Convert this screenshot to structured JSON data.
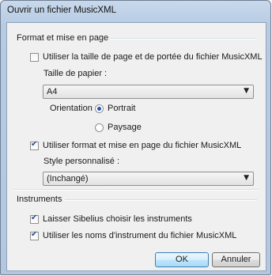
{
  "window": {
    "title": "Ouvrir un fichier MusicXML"
  },
  "format_section": {
    "label": "Format et mise en page",
    "use_page_size": {
      "label": "Utiliser la taille de page et de portée du fichier MusicXML",
      "checked": false
    },
    "paper_size": {
      "label": "Taille de papier :",
      "value": "A4"
    },
    "orientation": {
      "label": "Orientation :",
      "options": [
        {
          "label": "Portrait",
          "selected": true
        },
        {
          "label": "Paysage",
          "selected": false
        }
      ]
    },
    "use_format": {
      "label": "Utiliser format et mise en page du fichier MusicXML",
      "checked": true
    },
    "custom_style": {
      "label": "Style personnalisé :",
      "value": "(Inchangé)"
    }
  },
  "instruments_section": {
    "label": "Instruments",
    "let_sibelius": {
      "label": "Laisser Sibelius choisir les instruments",
      "checked": true
    },
    "use_names": {
      "label": "Utiliser les noms d'instrument du fichier MusicXML",
      "checked": true
    }
  },
  "buttons": {
    "ok": "OK",
    "cancel": "Annuler"
  },
  "icons": {
    "dropdown": "chevron-down-icon",
    "check": "checkmark-icon"
  }
}
